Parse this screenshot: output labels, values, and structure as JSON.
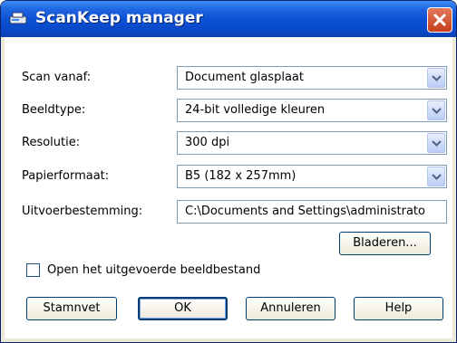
{
  "window": {
    "title": "ScanKeep manager"
  },
  "fields": [
    {
      "label": "Scan vanaf:",
      "value": "Document glasplaat"
    },
    {
      "label": "Beeldtype:",
      "value": "24-bit volledige kleuren"
    },
    {
      "label": "Resolutie:",
      "value": "300 dpi"
    },
    {
      "label": "Papierformaat:",
      "value": "B5 (182 x 257mm)"
    },
    {
      "label": "Uitvoerbestemming:",
      "value": "C:\\Documents and Settings\\administrato"
    }
  ],
  "buttons": {
    "browse": "Bladeren...",
    "scan": "Stamnvet",
    "ok": "OK",
    "cancel": "Annuleren",
    "help": "Help"
  },
  "checkbox": {
    "label": "Open het uitgevoerde beeldbestand",
    "checked": false
  },
  "colors": {
    "titlebar": "#0a4fd4",
    "close": "#c53e1a",
    "border": "#7f9db9"
  }
}
